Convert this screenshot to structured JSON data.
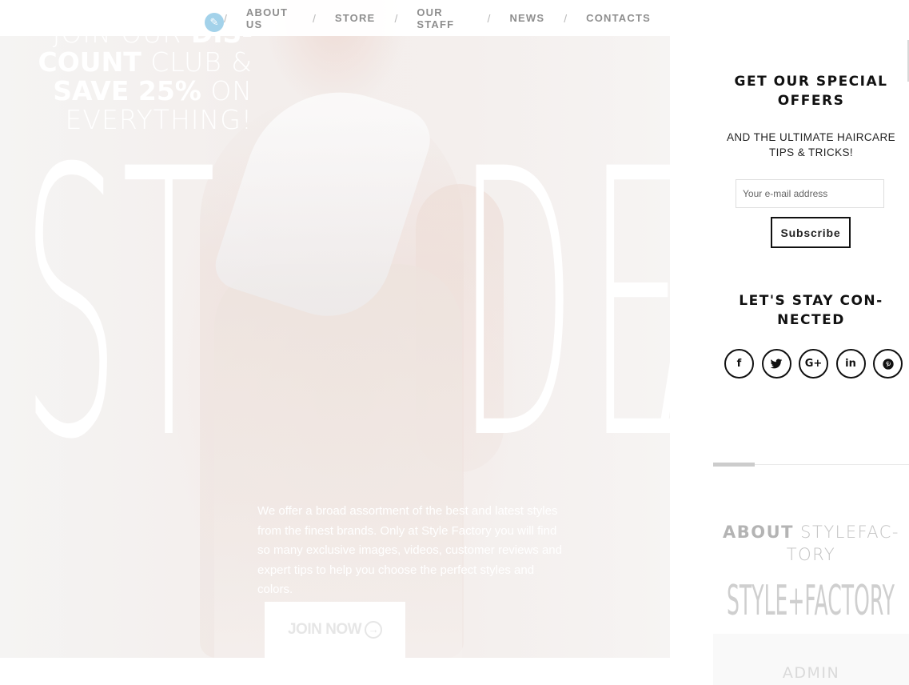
{
  "nav": {
    "items": [
      "ABOUT US",
      "STORE",
      "OUR STAFF",
      "NEWS",
      "CONTACTS"
    ],
    "separator": "/",
    "edit_icon": "pencil-icon"
  },
  "hero": {
    "promo": {
      "line1_light": "JOIN OUR ",
      "line1_bold": "DIS-",
      "line2_bold": "COUNT",
      "line2_light": " CLUB &",
      "line3_bold": "SAVE 25%",
      "line3_light": " ON",
      "line4_light": "EVERYTHING!"
    },
    "big_text": {
      "left_1": "S",
      "left_2": "T",
      "right_1": "D",
      "right_2": "E",
      "right_3": "A"
    },
    "description": "We offer a broad assortment of the best and latest styles from the finest brands. Only at Style Factory you will find so many exclusive images, videos, customer reviews and expert tips to help you choose the perfect styles and colors.",
    "join_button": "JOIN NOW",
    "join_icon": "arrow-right-circle-icon"
  },
  "sidebar": {
    "offers_title": "GET OUR SPECIAL OFFERS",
    "offers_subtitle": "AND THE ULTIMATE HAIRCARE TIPS & TRICKS!",
    "email_placeholder": "Your e-mail address",
    "subscribe_button": "Subscribe",
    "connect_title": "LET'S STAY CON-NECTED",
    "social": [
      {
        "icon": "facebook-icon",
        "glyph": "f"
      },
      {
        "icon": "twitter-icon",
        "glyph": "🐦"
      },
      {
        "icon": "google-plus-icon",
        "glyph": "G+"
      },
      {
        "icon": "linkedin-icon",
        "glyph": "in"
      },
      {
        "icon": "pinterest-icon",
        "glyph": "℗"
      }
    ],
    "about_bold": "ABOUT",
    "about_light": " STYLEFAC-TORY",
    "logo": "STYLE+FACTORY",
    "admin_label": "ADMIN"
  },
  "colors": {
    "accent_edit": "#a3d2ea",
    "nav_text": "#8e8e8e",
    "sidebar_title": "#111111"
  }
}
